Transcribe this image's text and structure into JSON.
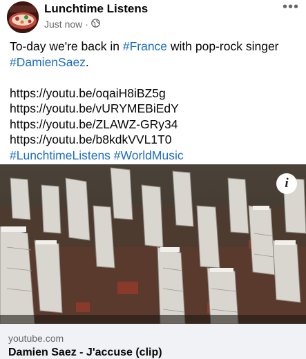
{
  "post": {
    "page_name": "Lunchtime Listens",
    "timestamp": "Just now",
    "separator": "·",
    "privacy_icon": "globe-icon",
    "more_icon": "more-options-icon",
    "more_label": "•••",
    "text": {
      "line1_pre": "To-day we're back in ",
      "line1_tag": "#France",
      "line1_post": " with pop-rock singer",
      "line2_tag": "#DamienSaez",
      "line2_post": ".",
      "links": [
        "https://youtu.be/oqaiH8iBZ5g",
        "https://youtu.be/vURYMEBiEdY",
        "https://youtu.be/ZLAWZ-GRy34",
        "https://youtu.be/b8kdkVVL1T0"
      ],
      "tag1": "#LunchtimeListens",
      "tag2": "#WorldMusic"
    }
  },
  "media": {
    "info_label": "i",
    "info_icon": "info-icon"
  },
  "preview": {
    "domain": "youtube.com",
    "title": "Damien Saez - J'accuse (clip)"
  },
  "colors": {
    "link": "#1b6ec2",
    "meta": "#65676b",
    "preview_bg": "#f0f2f5"
  }
}
